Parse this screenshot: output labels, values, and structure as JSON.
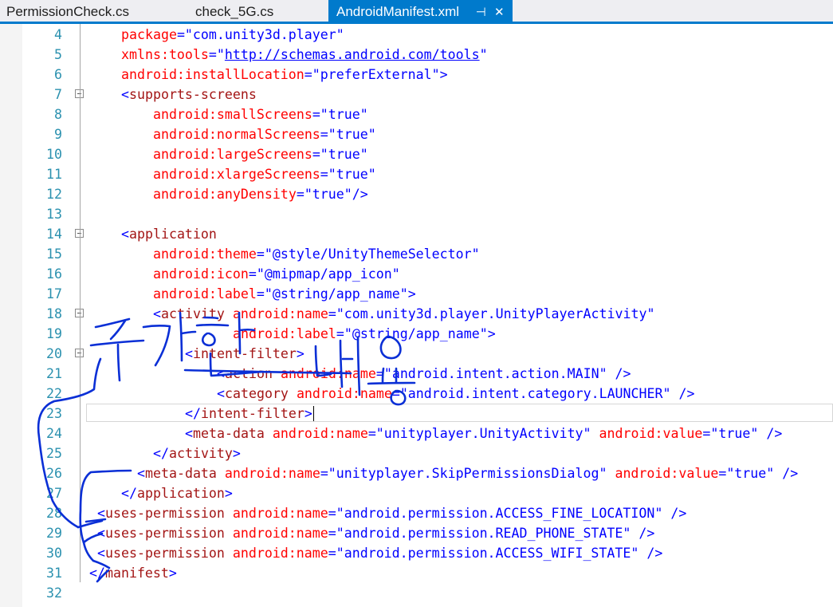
{
  "tabs": [
    {
      "label": "PermissionCheck.cs",
      "active": false
    },
    {
      "label": "check_5G.cs",
      "active": false
    },
    {
      "label": "AndroidManifest.xml",
      "active": true,
      "pin_icon": "pin-icon",
      "close_icon": "close-icon",
      "pin_glyph": "⊣",
      "close_glyph": "✕"
    }
  ],
  "colors": {
    "accent": "#007acc",
    "line_number": "#2b91af",
    "attribute": "#ff0000",
    "tag": "#a31515",
    "value": "#0000ff",
    "annotation_ink": "#0a2fd6"
  },
  "editor": {
    "current_line": 23,
    "lines": [
      {
        "n": "4",
        "fold": false,
        "indent": 4,
        "segs": [
          [
            "k",
            "package"
          ],
          [
            "b",
            "=\"com.unity3d.player\""
          ]
        ]
      },
      {
        "n": "5",
        "fold": false,
        "indent": 4,
        "segs": [
          [
            "k",
            "xmlns:tools"
          ],
          [
            "b",
            "=\""
          ],
          [
            "u",
            "http://schemas.android.com/tools"
          ],
          [
            "b",
            "\""
          ]
        ]
      },
      {
        "n": "6",
        "fold": false,
        "indent": 4,
        "segs": [
          [
            "k",
            "android:installLocation"
          ],
          [
            "b",
            "=\"preferExternal\">"
          ]
        ]
      },
      {
        "n": "7",
        "fold": true,
        "indent": 4,
        "segs": [
          [
            "b",
            "<"
          ],
          [
            "t",
            "supports-screens"
          ]
        ]
      },
      {
        "n": "8",
        "fold": false,
        "indent": 8,
        "segs": [
          [
            "k",
            "android:smallScreens"
          ],
          [
            "b",
            "=\"true\""
          ]
        ]
      },
      {
        "n": "9",
        "fold": false,
        "indent": 8,
        "segs": [
          [
            "k",
            "android:normalScreens"
          ],
          [
            "b",
            "=\"true\""
          ]
        ]
      },
      {
        "n": "10",
        "fold": false,
        "indent": 8,
        "segs": [
          [
            "k",
            "android:largeScreens"
          ],
          [
            "b",
            "=\"true\""
          ]
        ]
      },
      {
        "n": "11",
        "fold": false,
        "indent": 8,
        "segs": [
          [
            "k",
            "android:xlargeScreens"
          ],
          [
            "b",
            "=\"true\""
          ]
        ]
      },
      {
        "n": "12",
        "fold": false,
        "indent": 8,
        "segs": [
          [
            "k",
            "android:anyDensity"
          ],
          [
            "b",
            "=\"true\"/>"
          ]
        ]
      },
      {
        "n": "13",
        "fold": false,
        "indent": 0,
        "segs": []
      },
      {
        "n": "14",
        "fold": true,
        "indent": 4,
        "segs": [
          [
            "b",
            "<"
          ],
          [
            "t",
            "application"
          ]
        ]
      },
      {
        "n": "15",
        "fold": false,
        "indent": 8,
        "segs": [
          [
            "k",
            "android:theme"
          ],
          [
            "b",
            "=\"@style/UnityThemeSelector\""
          ]
        ]
      },
      {
        "n": "16",
        "fold": false,
        "indent": 8,
        "segs": [
          [
            "k",
            "android:icon"
          ],
          [
            "b",
            "=\"@mipmap/app_icon\""
          ]
        ]
      },
      {
        "n": "17",
        "fold": false,
        "indent": 8,
        "segs": [
          [
            "k",
            "android:label"
          ],
          [
            "b",
            "=\"@string/app_name\">"
          ]
        ]
      },
      {
        "n": "18",
        "fold": true,
        "indent": 8,
        "segs": [
          [
            "b",
            "<"
          ],
          [
            "t",
            "activity"
          ],
          [
            "b",
            " "
          ],
          [
            "k",
            "android:name"
          ],
          [
            "b",
            "=\"com.unity3d.player.UnityPlayerActivity\""
          ]
        ]
      },
      {
        "n": "19",
        "fold": false,
        "indent": 18,
        "segs": [
          [
            "k",
            "android:label"
          ],
          [
            "b",
            "=\"@string/app_name\">"
          ]
        ]
      },
      {
        "n": "20",
        "fold": true,
        "indent": 12,
        "segs": [
          [
            "b",
            "<"
          ],
          [
            "t",
            "intent-filter"
          ],
          [
            "b",
            ">"
          ]
        ]
      },
      {
        "n": "21",
        "fold": false,
        "indent": 16,
        "segs": [
          [
            "b",
            "<"
          ],
          [
            "t",
            "action"
          ],
          [
            "b",
            " "
          ],
          [
            "k",
            "android:name"
          ],
          [
            "b",
            "=\"android.intent.action.MAIN\" />"
          ]
        ]
      },
      {
        "n": "22",
        "fold": false,
        "indent": 16,
        "segs": [
          [
            "b",
            "<"
          ],
          [
            "t",
            "category"
          ],
          [
            "b",
            " "
          ],
          [
            "k",
            "android:name"
          ],
          [
            "b",
            "=\"android.intent.category.LAUNCHER\" />"
          ]
        ]
      },
      {
        "n": "23",
        "fold": false,
        "indent": 12,
        "segs": [
          [
            "b",
            "</"
          ],
          [
            "t",
            "intent-filter"
          ],
          [
            "b",
            ">"
          ]
        ]
      },
      {
        "n": "24",
        "fold": false,
        "indent": 12,
        "segs": [
          [
            "b",
            "<"
          ],
          [
            "t",
            "meta-data"
          ],
          [
            "b",
            " "
          ],
          [
            "k",
            "android:name"
          ],
          [
            "b",
            "=\"unityplayer.UnityActivity\" "
          ],
          [
            "k",
            "android:value"
          ],
          [
            "b",
            "=\"true\" />"
          ]
        ]
      },
      {
        "n": "25",
        "fold": false,
        "indent": 8,
        "segs": [
          [
            "b",
            "</"
          ],
          [
            "t",
            "activity"
          ],
          [
            "b",
            ">"
          ]
        ]
      },
      {
        "n": "26",
        "fold": false,
        "indent": 6,
        "segs": [
          [
            "b",
            "<"
          ],
          [
            "t",
            "meta-data"
          ],
          [
            "b",
            " "
          ],
          [
            "k",
            "android:name"
          ],
          [
            "b",
            "=\"unityplayer.SkipPermissionsDialog\" "
          ],
          [
            "k",
            "android:value"
          ],
          [
            "b",
            "=\"true\" />"
          ]
        ]
      },
      {
        "n": "27",
        "fold": false,
        "indent": 4,
        "segs": [
          [
            "b",
            "</"
          ],
          [
            "t",
            "application"
          ],
          [
            "b",
            ">"
          ]
        ]
      },
      {
        "n": "28",
        "fold": false,
        "indent": 1,
        "segs": [
          [
            "b",
            "<"
          ],
          [
            "t",
            "uses-permission"
          ],
          [
            "b",
            " "
          ],
          [
            "k",
            "android:name"
          ],
          [
            "b",
            "=\"android.permission.ACCESS_FINE_LOCATION\" />"
          ]
        ]
      },
      {
        "n": "29",
        "fold": false,
        "indent": 1,
        "segs": [
          [
            "b",
            "<"
          ],
          [
            "t",
            "uses-permission"
          ],
          [
            "b",
            " "
          ],
          [
            "k",
            "android:name"
          ],
          [
            "b",
            "=\"android.permission.READ_PHONE_STATE\" />"
          ]
        ]
      },
      {
        "n": "30",
        "fold": false,
        "indent": 1,
        "segs": [
          [
            "b",
            "<"
          ],
          [
            "t",
            "uses-permission"
          ],
          [
            "b",
            " "
          ],
          [
            "k",
            "android:name"
          ],
          [
            "b",
            "=\"android.permission.ACCESS_WIFI_STATE\" />"
          ]
        ]
      },
      {
        "n": "31",
        "fold": false,
        "indent": 0,
        "segs": [
          [
            "b",
            "</"
          ],
          [
            "t",
            "manifest"
          ],
          [
            "b",
            ">"
          ]
        ]
      },
      {
        "n": "32",
        "fold": false,
        "indent": 0,
        "segs": []
      }
    ]
  },
  "annotation": {
    "handwriting_text": "추가한 내용"
  }
}
